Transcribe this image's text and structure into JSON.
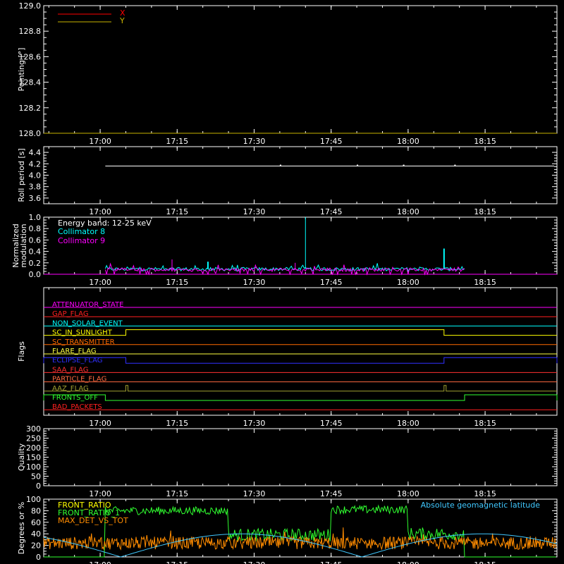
{
  "time_axis": {
    "start": "16:49",
    "end": "18:29",
    "ticks": [
      "17:00",
      "17:15",
      "17:30",
      "17:45",
      "18:00",
      "18:15"
    ]
  },
  "chart_data": [
    {
      "type": "line",
      "ylabel": "Pointing [°]",
      "ylim": [
        128.0,
        129.0
      ],
      "yticks": [
        "128.0",
        "128.2",
        "128.4",
        "128.6",
        "128.8",
        "129.0"
      ],
      "legend": "top-left",
      "series": [
        {
          "name": "X",
          "color": "#ff0000",
          "value": 128.0
        },
        {
          "name": "Y",
          "color": "#c8b400",
          "value": 128.0
        }
      ]
    },
    {
      "type": "line",
      "ylabel": "Roll period [s]",
      "ylim": [
        3.5,
        4.5
      ],
      "yticks": [
        "3.6",
        "3.8",
        "4.0",
        "4.2",
        "4.4"
      ],
      "series": [
        {
          "color": "#ffffff",
          "value": 4.16
        }
      ]
    },
    {
      "type": "line",
      "ylabel": [
        "Normalized",
        "modulation"
      ],
      "ylim": [
        0,
        1.0
      ],
      "yticks": [
        "0.0",
        "0.2",
        "0.4",
        "0.6",
        "0.8",
        "1.0"
      ],
      "annotations": {
        "energy_band": "Energy band: 12-25 keV"
      },
      "data_span": [
        "17:01",
        "18:11"
      ],
      "series": [
        {
          "name": "Collimator 8",
          "color": "#00ffff",
          "baseline": 0.09,
          "spikes": [
            [
              "17:40",
              1.0
            ],
            [
              "18:07",
              0.45
            ],
            [
              "17:21",
              0.22
            ]
          ]
        },
        {
          "name": "Collimator 9",
          "color": "#ff00ff",
          "baseline": 0.08,
          "spikes": [
            [
              "17:14",
              0.26
            ],
            [
              "17:38",
              0.2
            ]
          ]
        }
      ]
    },
    {
      "type": "flags",
      "ylabel": "Flags",
      "flags": [
        {
          "name": "ATTENUATOR_STATE",
          "color": "#ff00ff",
          "changes": []
        },
        {
          "name": "GAP_FLAG",
          "color": "#ff2020",
          "changes": []
        },
        {
          "name": "NON_SOLAR_EVENT",
          "color": "#00ffff",
          "changes": []
        },
        {
          "name": "SC_IN_SUNLIGHT",
          "color": "#ffff00",
          "changes": [
            [
              "17:05",
              "18:07"
            ]
          ]
        },
        {
          "name": "SC_TRANSMITTER",
          "color": "#ff6a00",
          "changes": []
        },
        {
          "name": "FLARE_FLAG",
          "color": "#ffff40",
          "changes": []
        },
        {
          "name": "ECLIPSE_FLAG",
          "color": "#3030ff",
          "changes": [
            [
              "16:49",
              "17:05"
            ],
            [
              "18:07",
              "18:29"
            ]
          ]
        },
        {
          "name": "SAA_FLAG",
          "color": "#ff3030",
          "changes": []
        },
        {
          "name": "PARTICLE_FLAG",
          "color": "#ff6a40",
          "changes": []
        },
        {
          "name": "AAZ_FLAG",
          "color": "#a0a030",
          "changes": [
            [
              "17:05",
              "17:05"
            ],
            [
              "18:07",
              "18:07"
            ]
          ]
        },
        {
          "name": "FRONTS_OFF",
          "color": "#30ff30",
          "changes": [
            [
              "16:49",
              "17:01"
            ],
            [
              "18:11",
              "18:29"
            ]
          ]
        },
        {
          "name": "BAD_PACKETS",
          "color": "#ff2020",
          "changes": []
        }
      ]
    },
    {
      "type": "line",
      "ylabel": "Quality",
      "ylim": [
        0,
        300
      ],
      "yticks": [
        "0",
        "50",
        "100",
        "150",
        "200",
        "250",
        "300"
      ],
      "series": [
        {
          "color": "#ffffff",
          "value": 0
        }
      ]
    },
    {
      "type": "line",
      "ylabel": "Degrees or %",
      "ylim": [
        0,
        100
      ],
      "yticks": [
        "0",
        "20",
        "40",
        "60",
        "80",
        "100"
      ],
      "annotations": {
        "right_legend": "Absolute geomagnetic latitude"
      },
      "series": [
        {
          "name": "FRONT_RATIO",
          "color": "#ffff00"
        },
        {
          "name": "FRONT_RATIO_1",
          "color": "#30ff30",
          "segments": [
            [
              "16:49",
              "17:01",
              0
            ],
            [
              "17:01",
              "17:05",
              80
            ],
            [
              "17:05",
              "17:25",
              80
            ],
            [
              "17:25",
              "17:45",
              38
            ],
            [
              "17:45",
              "18:00",
              82
            ],
            [
              "18:00",
              "18:11",
              40
            ],
            [
              "18:11",
              "18:29",
              0
            ]
          ]
        },
        {
          "name": "MAX_DET_VS_TOT",
          "color": "#ff8c00",
          "mean": 24
        },
        {
          "name": "Absolute geomagnetic latitude",
          "color": "#40c8ff"
        }
      ]
    }
  ]
}
